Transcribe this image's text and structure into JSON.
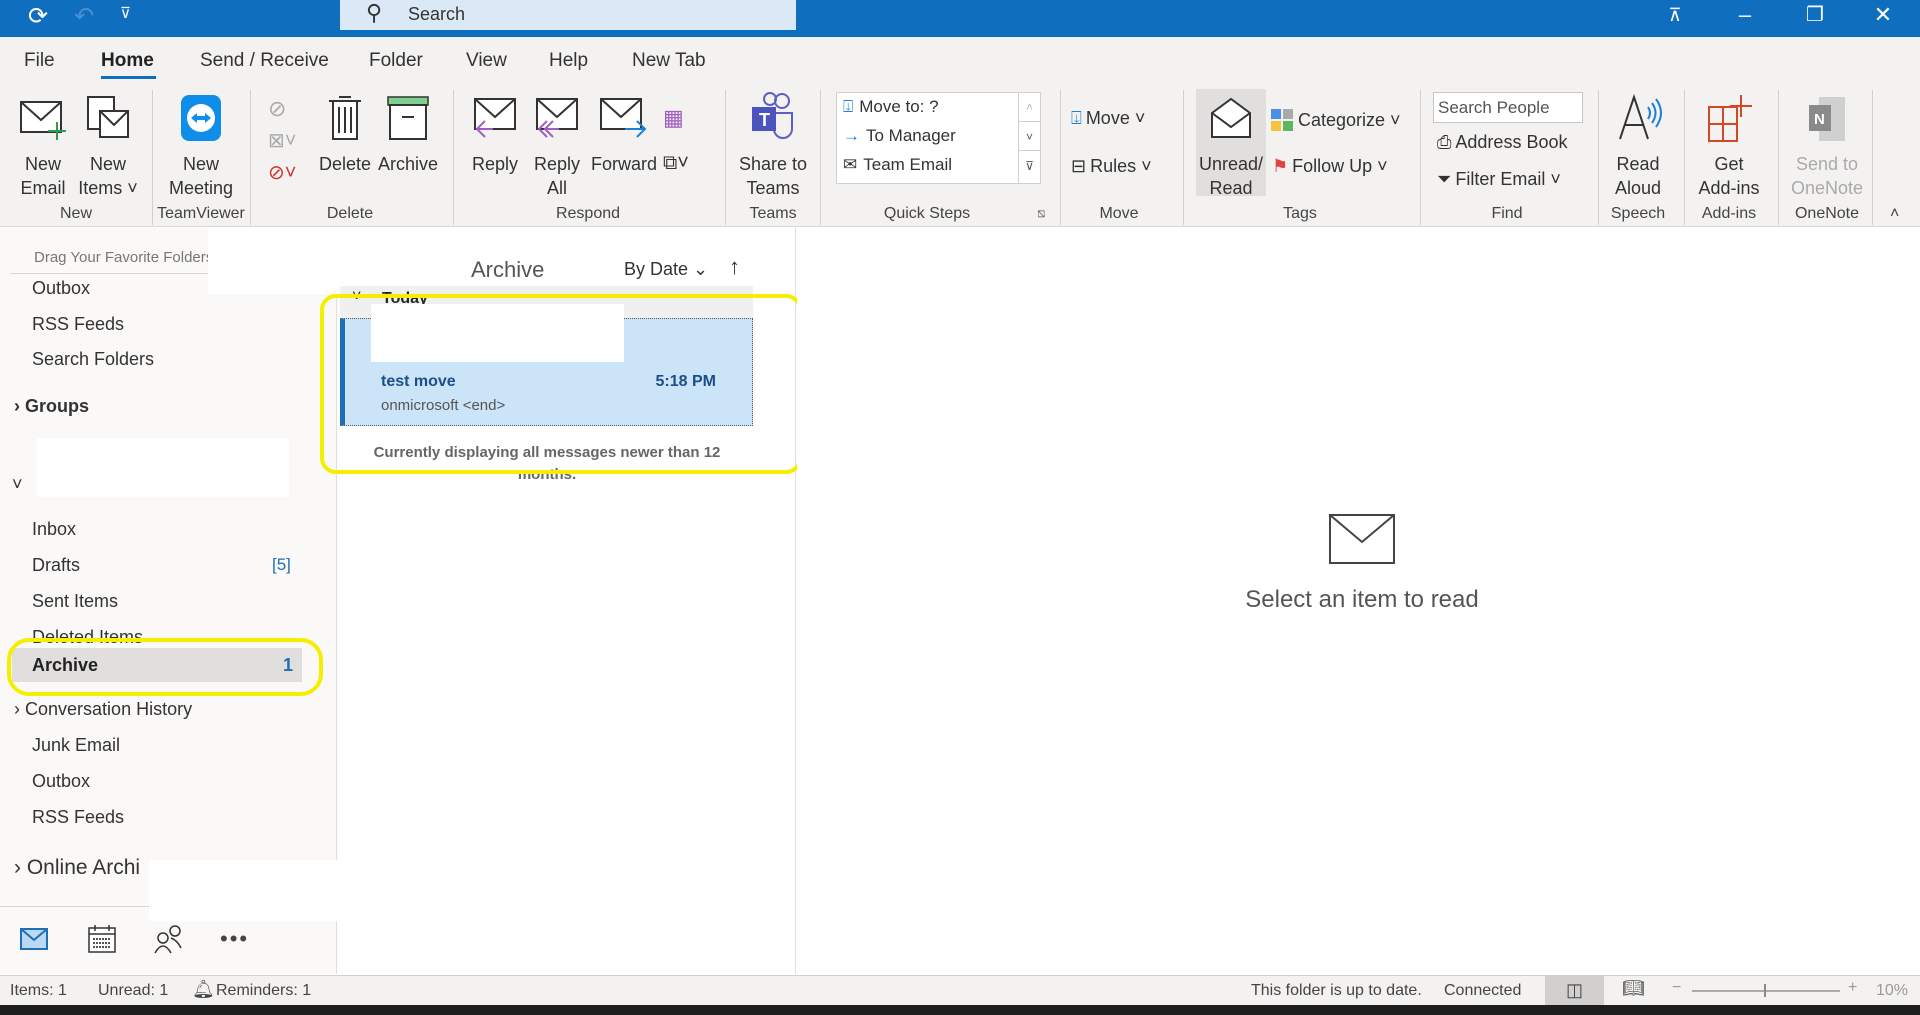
{
  "titlebar": {
    "search_placeholder": "Search",
    "icons": [
      "refresh-icon",
      "undo-icon",
      "customize-quick-access-icon",
      "ribbon-display-icon",
      "minimize-icon",
      "restore-icon",
      "close-icon"
    ]
  },
  "tabs": [
    "File",
    "Home",
    "Send / Receive",
    "Folder",
    "View",
    "Help",
    "New Tab"
  ],
  "selected_tab": "Home",
  "ribbon": {
    "new_email": [
      "New",
      "Email"
    ],
    "new_items": [
      "New",
      "Items ˅"
    ],
    "new_meeting": [
      "New",
      "Meeting"
    ],
    "delete": "Delete",
    "archive": "Archive",
    "reply": "Reply",
    "reply_all": [
      "Reply",
      "All"
    ],
    "forward": "Forward",
    "share_teams": [
      "Share to",
      "Teams"
    ],
    "quick_steps": [
      "Move to: ?",
      "To Manager",
      "Team Email"
    ],
    "move": "Move ˅",
    "rules": "Rules ˅",
    "unread_read": [
      "Unread/",
      "Read"
    ],
    "categorize": "Categorize ˅",
    "follow_up": "Follow Up ˅",
    "search_people_placeholder": "Search People",
    "address_book": "Address Book",
    "filter_email": "Filter Email ˅",
    "read_aloud": [
      "Read",
      "Aloud"
    ],
    "get_addins": [
      "Get",
      "Add-ins"
    ],
    "send_onenote": [
      "Send to",
      "OneNote"
    ],
    "groups": [
      "New",
      "TeamViewer",
      "Delete",
      "Respond",
      "Teams",
      "Quick Steps",
      "Move",
      "Tags",
      "Find",
      "Speech",
      "Add-ins",
      "OneNote"
    ]
  },
  "folders": {
    "favorites_hint": "Drag Your Favorite Folders Here",
    "top": [
      "Outbox",
      "RSS Feeds",
      "Search Folders"
    ],
    "groups": "Groups",
    "mailbox": [
      {
        "label": "Inbox",
        "count": ""
      },
      {
        "label": "Drafts",
        "count": "[5]"
      },
      {
        "label": "Sent Items",
        "count": ""
      },
      {
        "label": "Deleted Items",
        "count": ""
      },
      {
        "label": "Archive",
        "count": "1"
      },
      {
        "label": "Conversation History",
        "count": ""
      },
      {
        "label": "Junk Email",
        "count": ""
      },
      {
        "label": "Outbox",
        "count": ""
      },
      {
        "label": "RSS Feeds",
        "count": ""
      }
    ],
    "online_archive": "Online Archi"
  },
  "messages": {
    "folder_title": "Archive",
    "sort": "By Date",
    "group": "Today",
    "items": [
      {
        "subject": "test move",
        "time": "5:18 PM",
        "preview": "onmicrosoft <end>"
      }
    ],
    "footer": "Currently displaying all messages newer than 12 months."
  },
  "reading": {
    "empty": "Select an item to read"
  },
  "status": {
    "items": "Items: 1",
    "unread": "Unread: 1",
    "reminders": "Reminders: 1",
    "sync": "This folder is up to date.",
    "connection": "Connected",
    "zoom": "10%",
    "zoom_level_percent": 10
  },
  "colors": {
    "accent": "#106ebe",
    "highlight": "#f5ee00",
    "selected_item": "#cce4f7"
  }
}
